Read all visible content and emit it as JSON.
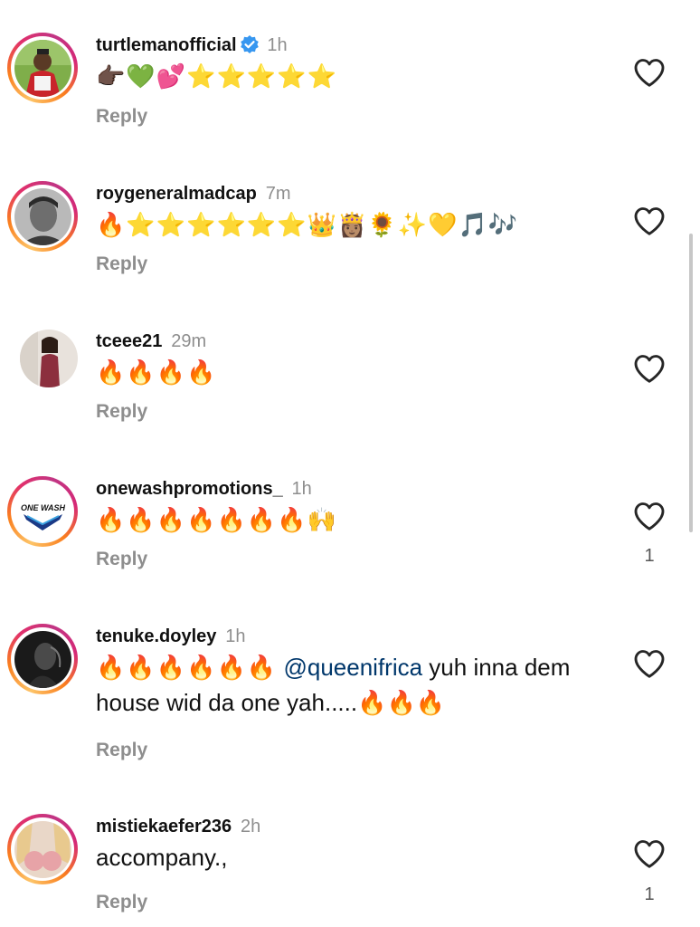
{
  "comments": [
    {
      "username": "turtlemanofficial",
      "verified": true,
      "time": "1h",
      "text": "👉🏿💚💕⭐⭐⭐⭐⭐",
      "reply_label": "Reply",
      "likes": ""
    },
    {
      "username": "roygeneralmadcap",
      "verified": false,
      "time": "7m",
      "text": "🔥⭐⭐⭐⭐⭐⭐👑👸🏽🌻✨💛🎵🎶",
      "reply_label": "Reply",
      "likes": ""
    },
    {
      "username": "tceee21",
      "verified": false,
      "time": "29m",
      "text": "🔥🔥🔥🔥",
      "reply_label": "Reply",
      "likes": ""
    },
    {
      "username": "onewashpromotions_",
      "verified": false,
      "time": "1h",
      "text": "🔥🔥🔥🔥🔥🔥🔥🙌",
      "reply_label": "Reply",
      "likes": "1",
      "avatar_text": "ONE WASH"
    },
    {
      "username": "tenuke.doyley",
      "verified": false,
      "time": "1h",
      "text_prefix": "🔥🔥🔥🔥🔥🔥",
      "mention": "@queenifrica",
      "text_suffix": " yuh inna dem house wid da one yah.....🔥🔥🔥",
      "reply_label": "Reply",
      "likes": ""
    },
    {
      "username": "mistiekaefer236",
      "verified": false,
      "time": "2h",
      "text": "accompany.,",
      "reply_label": "Reply",
      "likes": "1"
    }
  ],
  "icons": {
    "like": "heart-outline-icon",
    "verified": "verified-badge-icon"
  },
  "colors": {
    "username": "#111111",
    "secondary": "#8e8e8e",
    "mention": "#00376b",
    "verified": "#3797f0"
  }
}
